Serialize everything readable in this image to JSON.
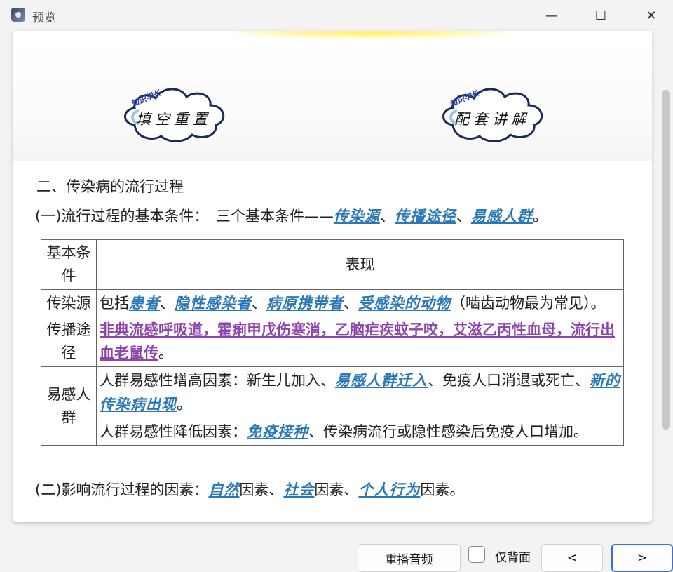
{
  "window": {
    "title": "预览",
    "minimize_glyph": "—",
    "maximize_glyph": "☐",
    "close_glyph": "✕"
  },
  "banner": {
    "left_cloud": {
      "tag": "知识学长",
      "text": "填空重置"
    },
    "right_cloud": {
      "tag": "知识学长",
      "text": "配套讲解"
    }
  },
  "section": {
    "title": "二、传染病的流行过程",
    "line1": {
      "prefix": "(一)流行过程的基本条件：　三个基本条件——",
      "kw1": "传染源",
      "sep1": "、",
      "kw2": "传播途径",
      "sep2": "、",
      "kw3": "易感人群",
      "end": "。"
    }
  },
  "table": {
    "header": {
      "col1": "基本条件",
      "col2": "表现"
    },
    "row1": {
      "label": "传染源",
      "pre": "包括",
      "kw1": "患者",
      "s1": "、",
      "kw2": "隐性感染者",
      "s2": "、",
      "kw3": "病原携带者",
      "s3": "、",
      "kw4": "受感染的动物",
      "post": "（啮齿动物最为常见）。"
    },
    "row2": {
      "label": "传播途径",
      "kw": "非典流感呼吸道，霍痢甲戊伤寒消，乙脑疟疾蚊子咬，艾滋乙丙性血母，流行出血老鼠传",
      "post": "。"
    },
    "row3": {
      "label": "易感人群",
      "a_pre": "人群易感性增高因素：新生儿加入、",
      "a_kw1": "易感人群迁入",
      "a_mid": "、免疫人口消退或死亡、",
      "a_kw2": "新的传染病出现",
      "a_end": "。",
      "b_pre": "人群易感性降低因素：",
      "b_kw": "免疫接种",
      "b_post": "、传染病流行或隐性感染后免疫人口增加。"
    }
  },
  "line2": {
    "prefix": "(二)影响流行过程的因素：",
    "kw1": "自然",
    "t1": "因素、",
    "kw2": "社会",
    "t2": "因素、",
    "kw3": "个人行为",
    "t3": "因素。"
  },
  "bottom": {
    "replay_label": "重播音频",
    "back_only_label": "仅背面",
    "back_only_checked": false,
    "prev_label": "<",
    "next_label": ">"
  }
}
